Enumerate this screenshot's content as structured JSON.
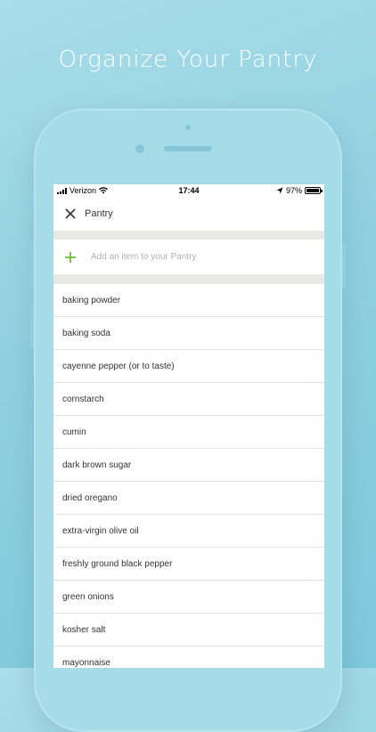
{
  "headline": "Organize Your Pantry",
  "status_bar": {
    "carrier": "Verizon",
    "time": "17:44",
    "battery": "97%",
    "battery_level": 0.97
  },
  "nav": {
    "title": "Pantry",
    "close_icon": "close-icon"
  },
  "add_item": {
    "placeholder": "Add an item to your Pantry",
    "icon": "plus-icon",
    "accent_color": "#6fbf3c"
  },
  "items": [
    "baking powder",
    "baking soda",
    "cayenne pepper (or to taste)",
    "cornstarch",
    "cumin",
    "dark brown sugar",
    "dried oregano",
    "extra-virgin olive oil",
    "freshly ground black pepper",
    "green onions",
    "kosher salt",
    "mayonnaise"
  ],
  "colors": {
    "background": "#8fd0e0",
    "phone": "#a6dbe8",
    "separator": "#e8e8e6"
  }
}
